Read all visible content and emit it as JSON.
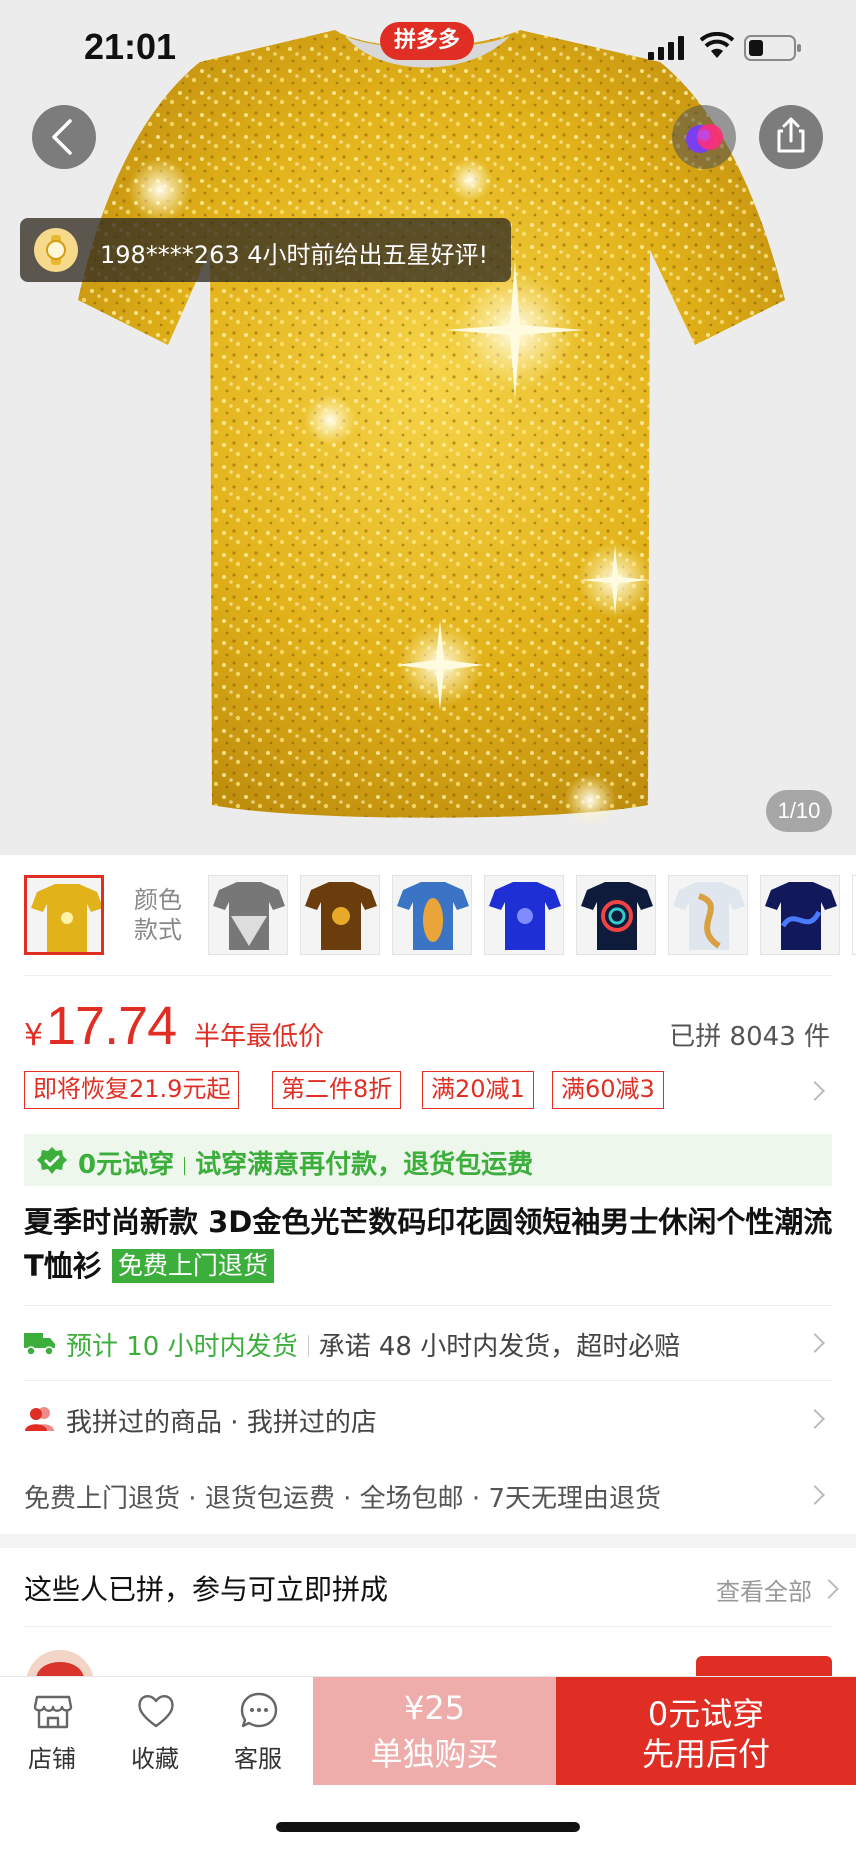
{
  "status_bar": {
    "time": "21:01"
  },
  "hero": {
    "brand_badge": "拼多多",
    "review_toast": "198****263 4小时前给出五星好评!",
    "image_counter": "1/10"
  },
  "variants": {
    "label": "颜色\n款式"
  },
  "price": {
    "currency": "¥",
    "value": "17.74",
    "note": "半年最低价",
    "sold": "已拼 8043 件"
  },
  "promos": [
    "即将恢复21.9元起",
    "第二件8折",
    "满20减1",
    "满60减3"
  ],
  "trial": {
    "label": "0元试穿",
    "desc": "试穿满意再付款，退货包运费"
  },
  "product": {
    "title": "夏季时尚新款 3D金色光芒数码印花圆领短袖男士休闲个性潮流T恤衫",
    "badge": "免费上门退货"
  },
  "shipping": {
    "estimate": "预计 10 小时内发货",
    "promise": "承诺 48 小时内发货，超时必赔"
  },
  "history": {
    "items": "我拼过的商品",
    "stores": "我拼过的店"
  },
  "services": [
    "免费上门退货",
    "退货包运费",
    "全场包邮",
    "7天无理由退货"
  ],
  "group": {
    "heading": "这些人已拼，参与可立即拼成",
    "view_all": "查看全部"
  },
  "bottom_bar": {
    "tabs": [
      {
        "label": "店铺",
        "icon": "store-icon"
      },
      {
        "label": "收藏",
        "icon": "heart-icon"
      },
      {
        "label": "客服",
        "icon": "chat-icon"
      }
    ],
    "buy_solo": {
      "price": "¥25",
      "label": "单独购买"
    },
    "buy_group": {
      "line1": "0元试穿",
      "line2": "先用后付"
    }
  },
  "colors": {
    "accent": "#e02e24",
    "green": "#3cae3c",
    "gold": "#d9a514"
  }
}
